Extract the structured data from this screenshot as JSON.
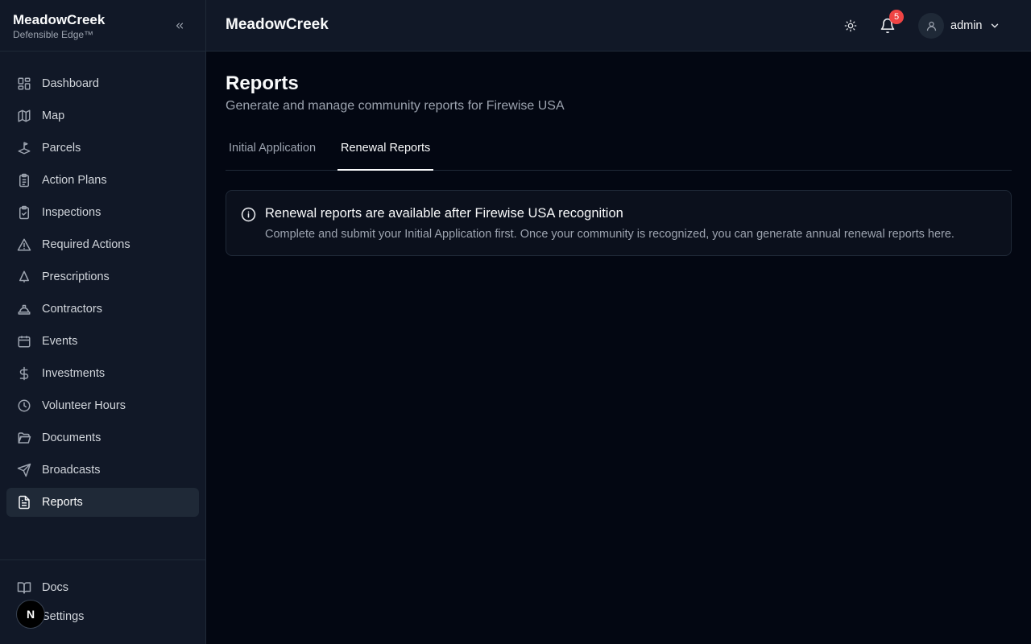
{
  "brand": {
    "name": "MeadowCreek",
    "tagline": "Defensible Edge™"
  },
  "sidebar": {
    "items": [
      {
        "label": "Dashboard",
        "icon": "dashboard-icon"
      },
      {
        "label": "Map",
        "icon": "map-icon"
      },
      {
        "label": "Parcels",
        "icon": "parcels-icon"
      },
      {
        "label": "Action Plans",
        "icon": "clipboard-list-icon"
      },
      {
        "label": "Inspections",
        "icon": "clipboard-check-icon"
      },
      {
        "label": "Required Actions",
        "icon": "warning-icon"
      },
      {
        "label": "Prescriptions",
        "icon": "tree-icon"
      },
      {
        "label": "Contractors",
        "icon": "hard-hat-icon"
      },
      {
        "label": "Events",
        "icon": "calendar-icon"
      },
      {
        "label": "Investments",
        "icon": "dollar-icon"
      },
      {
        "label": "Volunteer Hours",
        "icon": "clock-icon"
      },
      {
        "label": "Documents",
        "icon": "folder-icon"
      },
      {
        "label": "Broadcasts",
        "icon": "send-icon"
      },
      {
        "label": "Reports",
        "icon": "file-text-icon",
        "active": true
      }
    ],
    "bottom": [
      {
        "label": "Docs",
        "icon": "book-icon"
      },
      {
        "label": "Settings",
        "icon": "settings-icon"
      }
    ],
    "avatar_letter": "N"
  },
  "header": {
    "title": "MeadowCreek",
    "notifications_count": "5",
    "user": "admin"
  },
  "page": {
    "title": "Reports",
    "subtitle": "Generate and manage community reports for Firewise USA",
    "tabs": [
      {
        "label": "Initial Application",
        "active": false
      },
      {
        "label": "Renewal Reports",
        "active": true
      }
    ],
    "alert": {
      "title": "Renewal reports are available after Firewise USA recognition",
      "body": "Complete and submit your Initial Application first. Once your community is recognized, you can generate annual renewal reports here."
    }
  },
  "colors": {
    "background": "#030712",
    "surface": "#111827",
    "border": "#1f2937",
    "badge": "#ef4444"
  }
}
